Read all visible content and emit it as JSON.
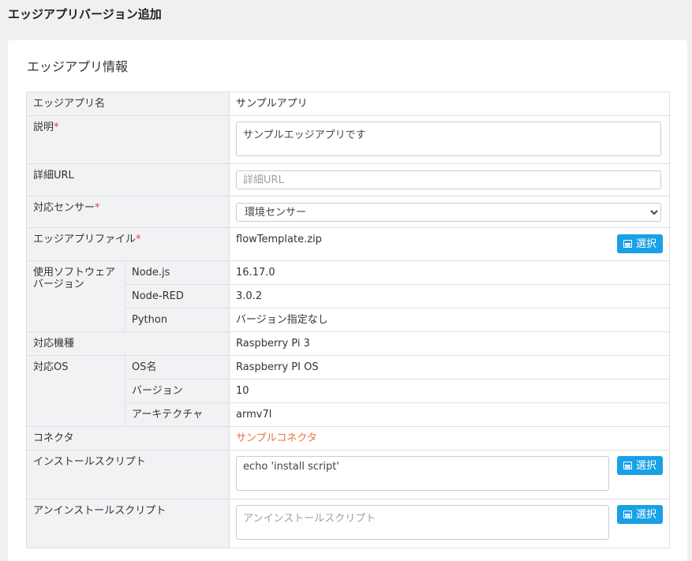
{
  "page": {
    "title": "エッジアプリバージョン追加"
  },
  "section": {
    "title": "エッジアプリ情報"
  },
  "rows": {
    "app_name": {
      "label": "エッジアプリ名",
      "value": "サンプルアプリ"
    },
    "description": {
      "label": "説明",
      "required_mark": "*",
      "value": "サンプルエッジアプリです"
    },
    "detail_url": {
      "label": "詳細URL",
      "placeholder": "詳細URL"
    },
    "sensor": {
      "label": "対応センサー",
      "required_mark": "*",
      "selected": "環境センサー"
    },
    "app_file": {
      "label": "エッジアプリファイル",
      "required_mark": "*",
      "value": "flowTemplate.zip",
      "button": "選択"
    },
    "software": {
      "label": "使用ソフトウェアバージョン",
      "items": [
        {
          "name": "Node.js",
          "value": "16.17.0"
        },
        {
          "name": "Node-RED",
          "value": "3.0.2"
        },
        {
          "name": "Python",
          "value": "バージョン指定なし"
        }
      ]
    },
    "device": {
      "label": "対応機種",
      "value": "Raspberry Pi 3"
    },
    "os": {
      "label": "対応OS",
      "items": [
        {
          "name": "OS名",
          "value": "Raspberry PI OS"
        },
        {
          "name": "バージョン",
          "value": "10"
        },
        {
          "name": "アーキテクチャ",
          "value": "armv7l"
        }
      ]
    },
    "connector": {
      "label": "コネクタ",
      "value": "サンプルコネクタ"
    },
    "install_script": {
      "label": "インストールスクリプト",
      "value": "echo 'install script'",
      "button": "選択"
    },
    "uninstall_script": {
      "label": "アンインストールスクリプト",
      "placeholder": "アンインストールスクリプト",
      "button": "選択"
    }
  },
  "colors": {
    "accent": "#1aa0e6",
    "link": "#e8743b",
    "required": "#e23b3b"
  }
}
